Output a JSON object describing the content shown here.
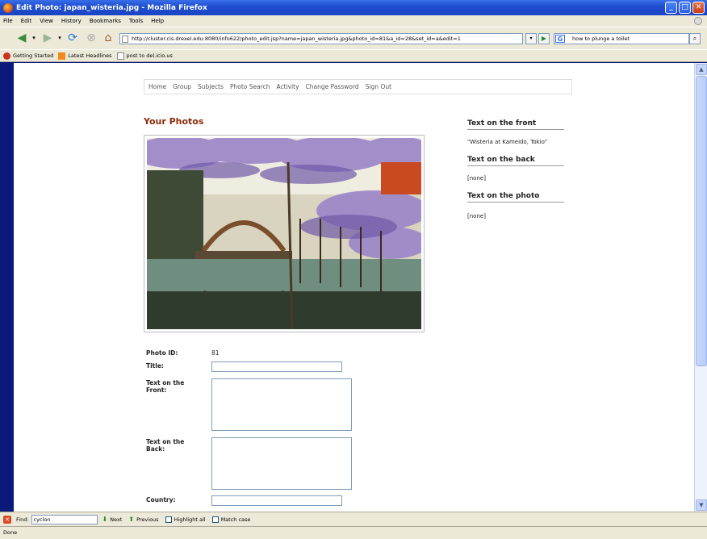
{
  "window": {
    "title": "Edit Photo: japan_wisteria.jpg - Mozilla Firefox"
  },
  "menu": [
    "File",
    "Edit",
    "View",
    "History",
    "Bookmarks",
    "Tools",
    "Help"
  ],
  "navbar": {
    "url": "http://cluster.cis.drexel.edu:8080/info622/photo_edit.jsp?name=japan_wisteria.jpg&photo_id=81&a_id=28&set_id=a&edit=1",
    "search_value": "how to plunge a toilet"
  },
  "bookmarks": [
    "Getting Started",
    "Latest Headlines",
    "post to del.icio.us"
  ],
  "sitenav": [
    "Home",
    "Group",
    "Subjects",
    "Photo Search",
    "Activity",
    "Change Password",
    "Sign Out"
  ],
  "page": {
    "heading": "Your Photos"
  },
  "side": {
    "front_heading": "Text on the front",
    "front_value": "\"Wisteria at Kameido, Tokio\"",
    "back_heading": "Text on the back",
    "back_value": "[none]",
    "photo_heading": "Text on the photo",
    "photo_value": "[none]"
  },
  "form": {
    "photo_id_label": "Photo ID:",
    "photo_id_value": "81",
    "title_label": "Title:",
    "front_label": "Text on the Front:",
    "back_label": "Text on the Back:",
    "country_label": "Country:"
  },
  "findbar": {
    "label": "Find:",
    "value": "cyclon",
    "next": "Next",
    "previous": "Previous",
    "highlight": "Highlight all",
    "match_case": "Match case"
  },
  "status": "Done"
}
